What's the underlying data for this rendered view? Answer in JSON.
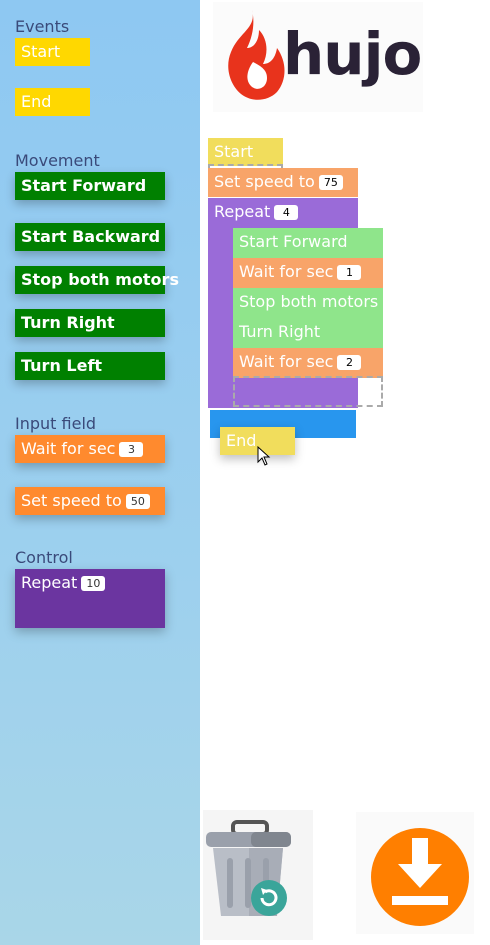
{
  "palette": {
    "sections": {
      "events": "Events",
      "movement": "Movement",
      "input_field": "Input field",
      "control": "Control"
    },
    "events": [
      "Start",
      "End"
    ],
    "movement": [
      "Start Forward",
      "Start Backward",
      "Stop both motors",
      "Turn Right",
      "Turn Left"
    ],
    "input_field": [
      {
        "label": "Wait for sec",
        "value": "3"
      },
      {
        "label": "Set speed to",
        "value": "50"
      }
    ],
    "control": [
      {
        "label": "Repeat",
        "value": "10"
      }
    ]
  },
  "logo": {
    "text": "hujo",
    "icon": "flame-icon"
  },
  "program": {
    "start": "Start",
    "set_speed": {
      "label": "Set speed to",
      "value": "75"
    },
    "repeat": {
      "label": "Repeat",
      "value": "4"
    },
    "inner": {
      "b1": "Start Forward",
      "b2": {
        "label": "Wait for sec",
        "value": "1"
      },
      "b3": "Stop both motors",
      "b4": "Turn Right",
      "b5": {
        "label": "Wait for sec",
        "value": "2"
      }
    },
    "dragging": "End"
  },
  "controls": {
    "trash_icon": "trash-icon",
    "restore_icon": "restore-icon",
    "download_icon": "download-icon"
  },
  "colors": {
    "events": "#ffd800",
    "movement": "#008000",
    "input": "#ff8a2e",
    "control": "#6b35a0",
    "download": "#ff7f00",
    "restore": "#3aa59a"
  }
}
